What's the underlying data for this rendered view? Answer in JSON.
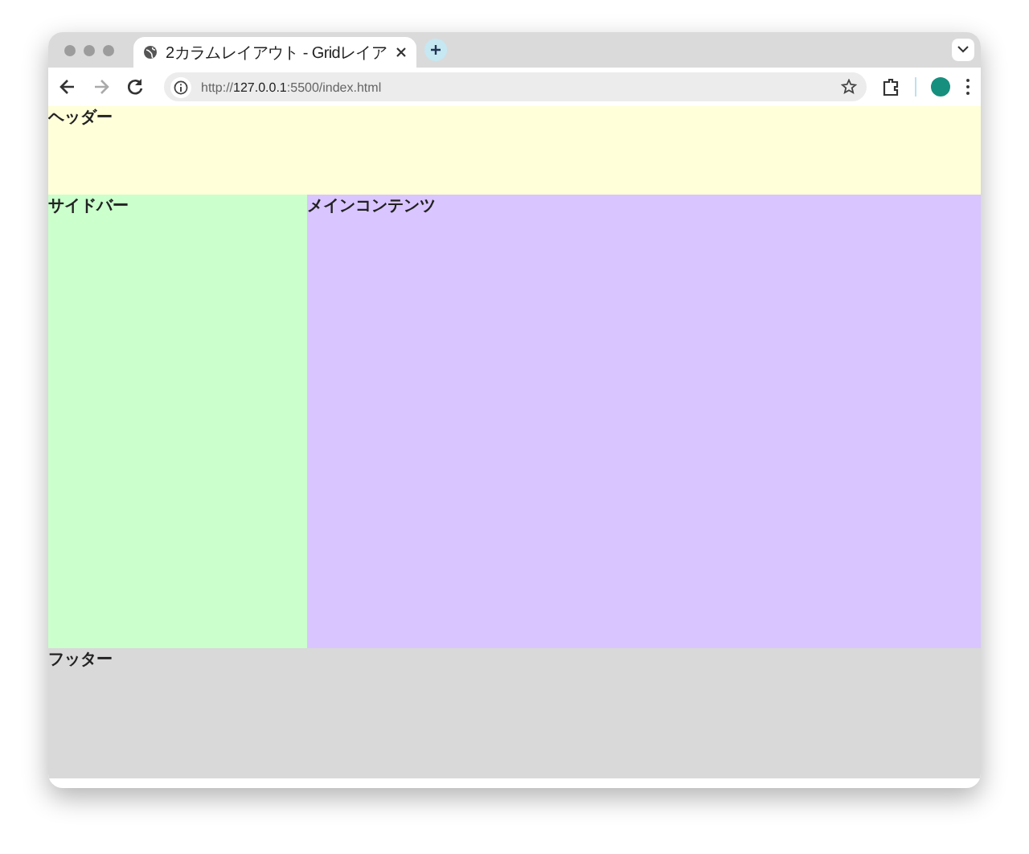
{
  "browser": {
    "tabs": [
      {
        "title": "2カラムレイアウト - Gridレイア",
        "selected": true
      }
    ],
    "address": {
      "value": "http://**127.0.0.1**:5500/index.html"
    }
  },
  "page": {
    "header": "ヘッダー",
    "sidebar": "サイドバー",
    "main": "メインコンテンツ",
    "footer": "フッター"
  }
}
